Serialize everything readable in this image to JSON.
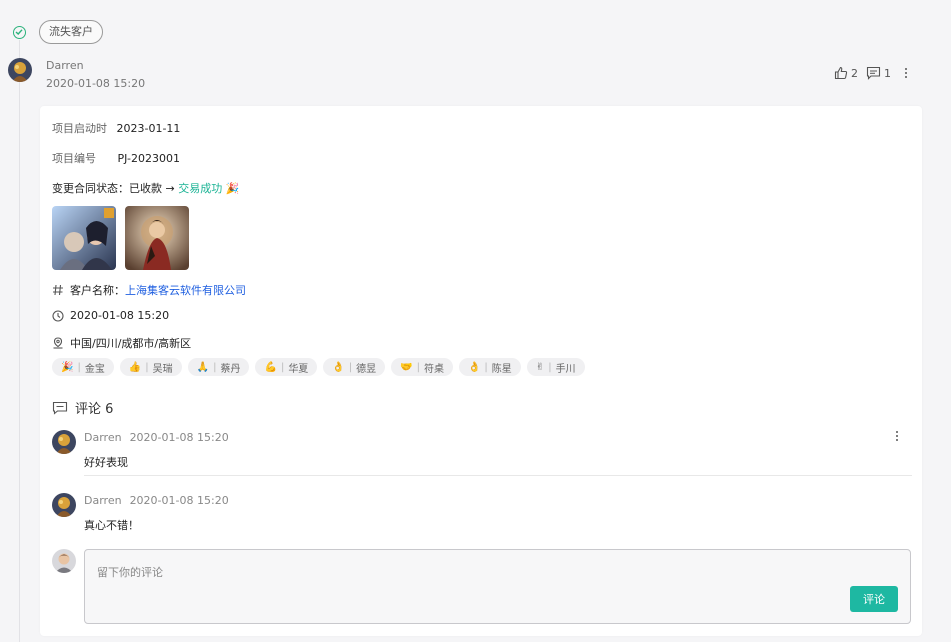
{
  "stage": {
    "tag": "流失客户"
  },
  "post": {
    "author": "Darren",
    "time": "2020-01-08 15:20",
    "likes": "2",
    "comments_count": "1"
  },
  "details": {
    "start_label": "项目启动时",
    "start_value": "2023-01-11",
    "number_label": "项目编号",
    "number_value": "PJ-2023001",
    "status_prefix": "变更合同状态：已收款 → ",
    "status_result": "交易成功",
    "status_emoji": "🎉",
    "customer_label": "客户名称：",
    "customer_value": "上海集客云软件有限公司",
    "datetime": "2020-01-08 15:20",
    "location": "中国/四川/成都市/高新区"
  },
  "reactions": [
    {
      "emoji": "🎉",
      "name": "金宝"
    },
    {
      "emoji": "👍",
      "name": "吴瑞"
    },
    {
      "emoji": "🙏",
      "name": "蔡丹"
    },
    {
      "emoji": "💪",
      "name": "华夏"
    },
    {
      "emoji": "👌",
      "name": "德昱"
    },
    {
      "emoji": "🤝",
      "name": "符桌"
    },
    {
      "emoji": "👌",
      "name": "陈星"
    },
    {
      "emoji": "✌",
      "name": "手川"
    }
  ],
  "comments_section": {
    "title": "评论 6",
    "items": [
      {
        "author": "Darren",
        "time": "2020-01-08 15:20",
        "text": "好好表现"
      },
      {
        "author": "Darren",
        "time": "2020-01-08 15:20",
        "text": "真心不错！"
      }
    ]
  },
  "composer": {
    "placeholder": "留下你的评论",
    "submit_label": "评论"
  },
  "colors": {
    "accent": "#1eb8a2",
    "success": "#2ab27b",
    "link": "#1f5fe0"
  }
}
